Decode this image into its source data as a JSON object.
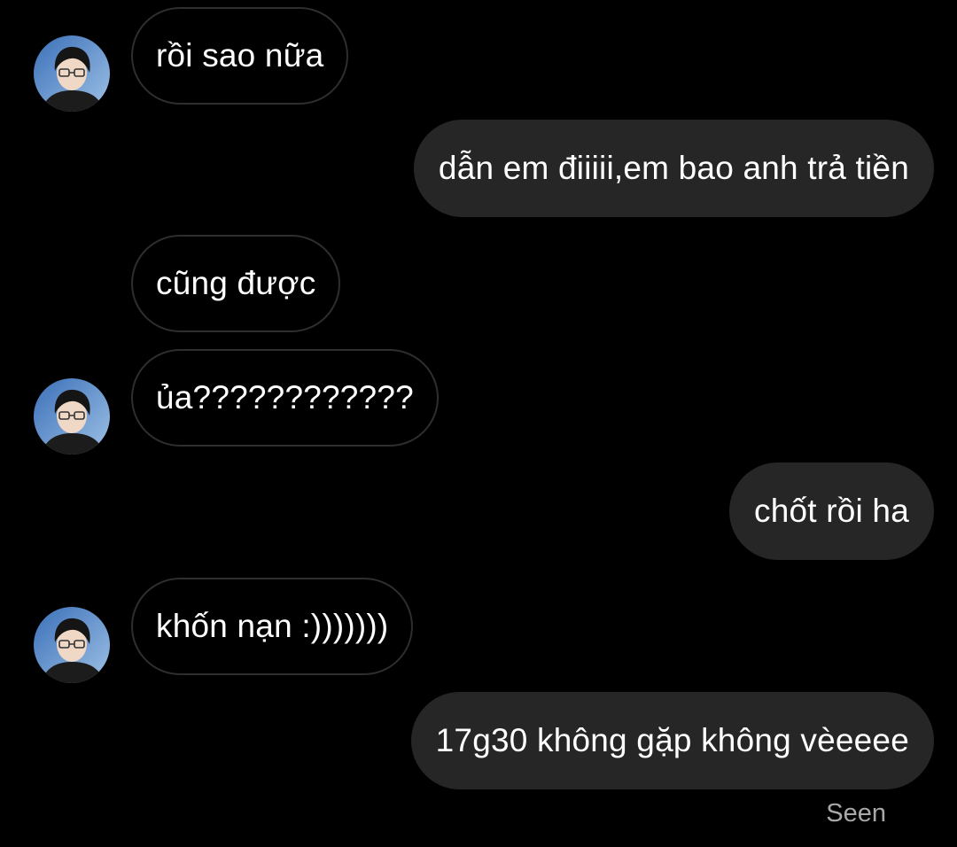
{
  "colors": {
    "background": "#000000",
    "outgoing_bubble": "#262626",
    "incoming_bubble_border": "#2e2e2e",
    "text": "#ffffff",
    "seen_text": "#a8a8a8"
  },
  "contact": {
    "avatar_icon": "profile-photo"
  },
  "messages": [
    {
      "direction": "incoming",
      "text": "rồi sao nữa",
      "show_avatar": true
    },
    {
      "direction": "outgoing",
      "text": "dẫn em điiiii,em bao anh trả tiền"
    },
    {
      "direction": "incoming",
      "text": "cũng được",
      "show_avatar": false
    },
    {
      "direction": "incoming",
      "text": "ủa????????????",
      "show_avatar": true
    },
    {
      "direction": "outgoing",
      "text": "chốt rồi ha"
    },
    {
      "direction": "incoming",
      "text": "khốn nạn :)))))))",
      "show_avatar": true
    },
    {
      "direction": "outgoing",
      "text": "17g30 không gặp không vèeeee"
    }
  ],
  "status": {
    "seen_label": "Seen"
  }
}
